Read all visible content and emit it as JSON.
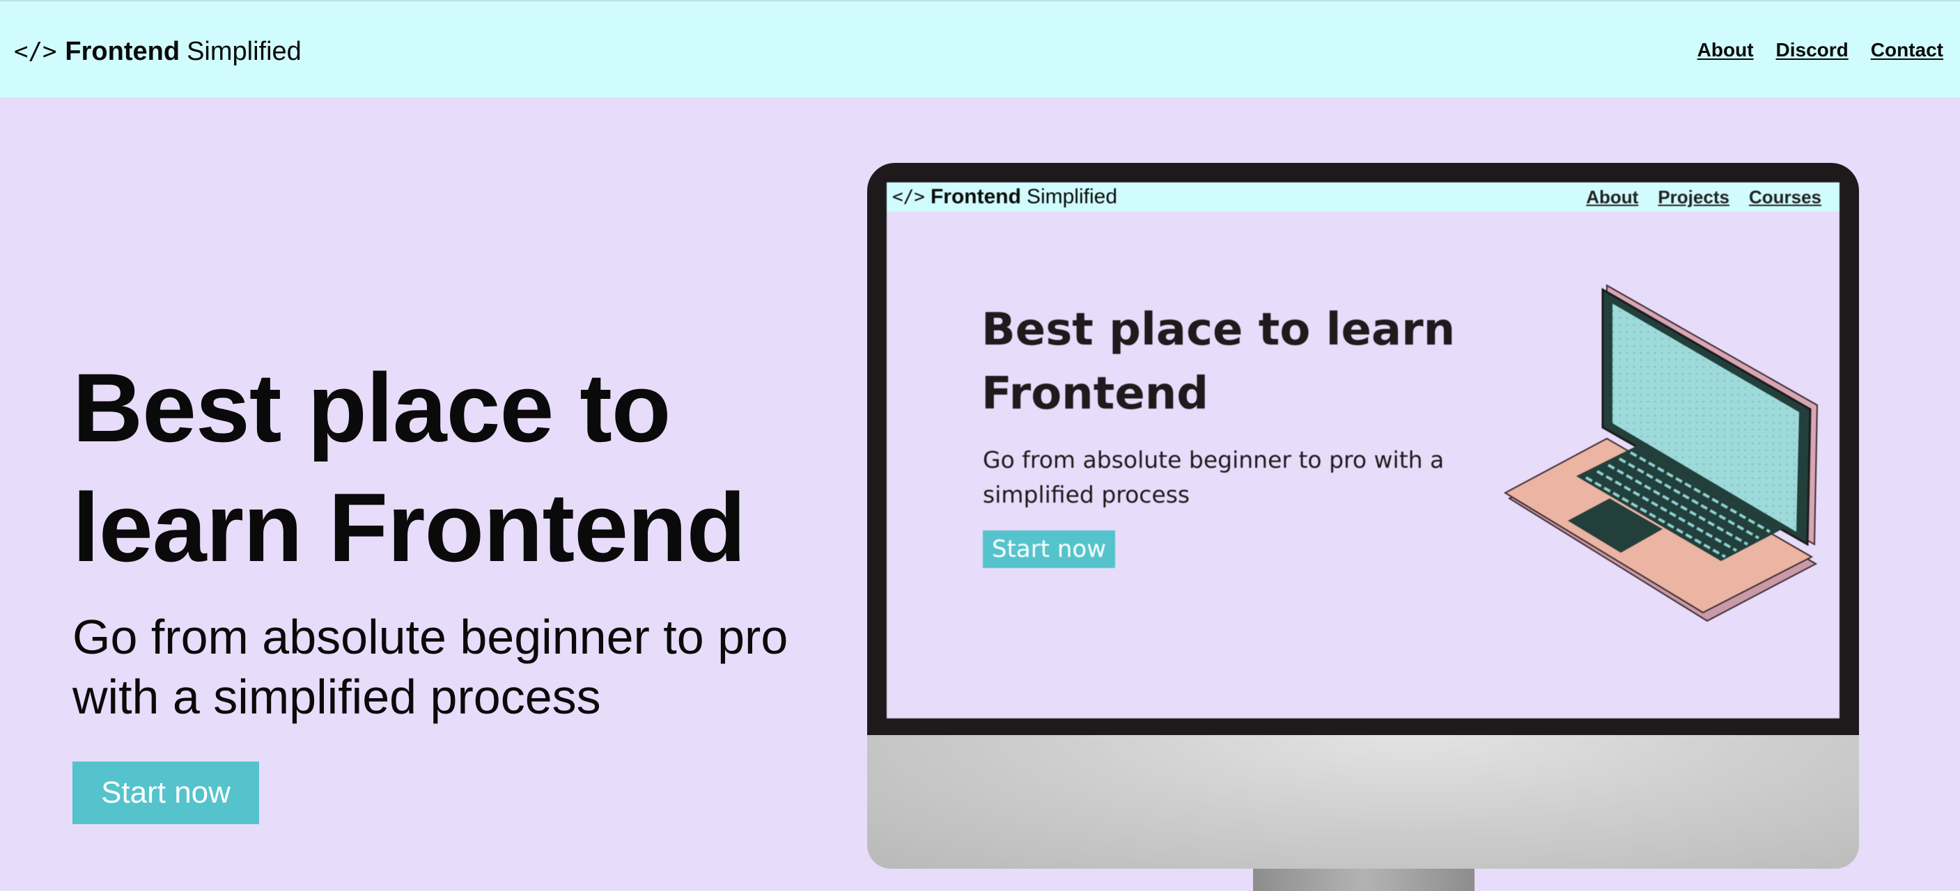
{
  "header": {
    "logo": {
      "glyph": "</>",
      "bold": "Frontend",
      "light": "Simplified"
    },
    "nav": [
      {
        "label": "About"
      },
      {
        "label": "Discord"
      },
      {
        "label": "Contact"
      }
    ]
  },
  "hero": {
    "title_line1": "Best place to",
    "title_line2": "learn Frontend",
    "subtitle_line1": "Go from absolute beginner to pro",
    "subtitle_line2": "with a simplified process",
    "cta_label": "Start now"
  },
  "monitor_screen": {
    "logo": {
      "glyph": "</>",
      "bold": "Frontend",
      "light": "Simplified"
    },
    "nav": [
      {
        "label": "About"
      },
      {
        "label": "Projects"
      },
      {
        "label": "Courses"
      }
    ],
    "title_line1": "Best place to learn",
    "title_line2": "Frontend",
    "subtitle_line1": "Go from absolute beginner to pro with a",
    "subtitle_line2": "simplified process",
    "cta_label": "Start now"
  },
  "colors": {
    "page_background": "#e8dcfb",
    "navbar_background": "#d1fcfd",
    "accent": "#55c3cb",
    "text": "#0a0a0a",
    "monitor_bezel": "#1e1a1c",
    "laptop_body": "#ecb4a2",
    "laptop_screen": "#9fdada"
  },
  "icons": {
    "logo_icon": "code-brackets-icon",
    "illustration": "laptop-illustration"
  }
}
